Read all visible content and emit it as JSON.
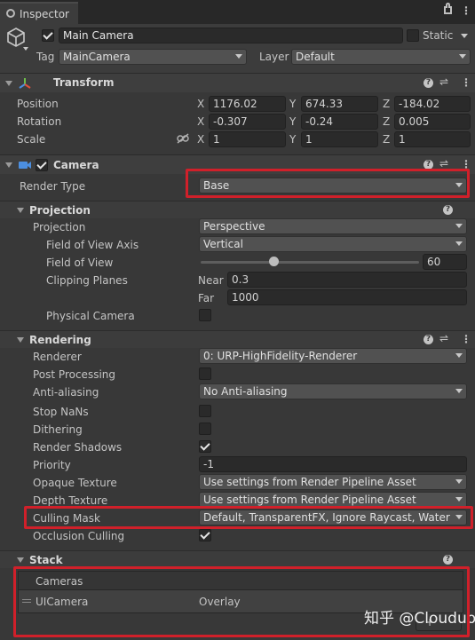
{
  "tab": {
    "title": "Inspector",
    "lock_icon": "lock-icon",
    "menu_icon": "kebab-menu-icon"
  },
  "object": {
    "active": true,
    "name": "Main Camera",
    "static_label": "Static",
    "static_checked": false,
    "tag_label": "Tag",
    "tag_value": "MainCamera",
    "layer_label": "Layer",
    "layer_value": "Default"
  },
  "transform": {
    "title": "Transform",
    "position": {
      "label": "Position",
      "x": "1176.02",
      "y": "674.33",
      "z": "-184.02"
    },
    "rotation": {
      "label": "Rotation",
      "x": "-0.307",
      "y": "-0.24",
      "z": "0.005"
    },
    "scale": {
      "label": "Scale",
      "x": "1",
      "y": "1",
      "z": "1"
    },
    "axis_x": "X",
    "axis_y": "Y",
    "axis_z": "Z"
  },
  "camera": {
    "title": "Camera",
    "enabled": true,
    "render_type_label": "Render Type",
    "render_type_value": "Base"
  },
  "projection": {
    "title": "Projection",
    "projection_label": "Projection",
    "projection_value": "Perspective",
    "fov_axis_label": "Field of View Axis",
    "fov_axis_value": "Vertical",
    "fov_label": "Field of View",
    "fov_value": "60",
    "clipping_label": "Clipping Planes",
    "near_label": "Near",
    "near_value": "0.3",
    "far_label": "Far",
    "far_value": "1000",
    "physical_label": "Physical Camera",
    "physical_checked": false
  },
  "rendering": {
    "title": "Rendering",
    "renderer_label": "Renderer",
    "renderer_value": "0: URP-HighFidelity-Renderer",
    "post_label": "Post Processing",
    "post_checked": false,
    "aa_label": "Anti-aliasing",
    "aa_value": "No Anti-aliasing",
    "stopnans_label": "Stop NaNs",
    "stopnans_checked": false,
    "dither_label": "Dithering",
    "dither_checked": false,
    "shadows_label": "Render Shadows",
    "shadows_checked": true,
    "priority_label": "Priority",
    "priority_value": "-1",
    "opaque_label": "Opaque Texture",
    "opaque_value": "Use settings from Render Pipeline Asset",
    "depth_label": "Depth Texture",
    "depth_value": "Use settings from Render Pipeline Asset",
    "culling_label": "Culling Mask",
    "culling_value": "Default, TransparentFX, Ignore Raycast, Water",
    "occlusion_label": "Occlusion Culling",
    "occlusion_checked": true
  },
  "stack": {
    "title": "Stack",
    "list_header": "Cameras",
    "items": [
      {
        "name": "UICamera",
        "type": "Overlay"
      }
    ],
    "add_button": "+"
  },
  "watermark": "知乎 @Clouduo",
  "colors": {
    "highlight": "#d0202a",
    "background": "#383838",
    "field": "#2a2a2a"
  }
}
